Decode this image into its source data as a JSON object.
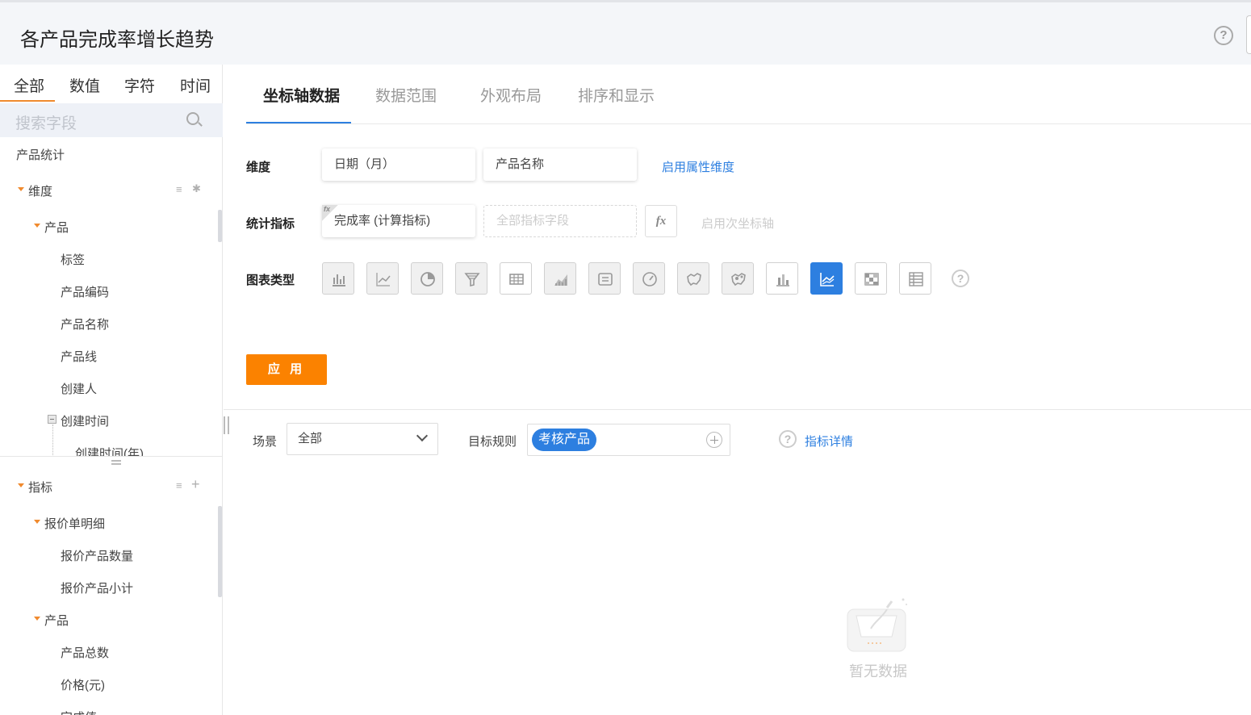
{
  "header": {
    "title": "各产品完成率增长趋势"
  },
  "sidebar": {
    "field_tabs": [
      "全部",
      "数值",
      "字符",
      "时间"
    ],
    "search_placeholder": "搜索字段",
    "dataset": "产品统计",
    "dimensions": {
      "label": "维度",
      "group": "产品",
      "fields": [
        "标签",
        "产品编码",
        "产品名称",
        "产品线",
        "创建人"
      ],
      "date_group": "创建时间",
      "date_child": "创建时间(年)"
    },
    "metrics": {
      "label": "指标",
      "groups": [
        {
          "name": "报价单明细",
          "fields": [
            "报价产品数量",
            "报价产品小计"
          ]
        },
        {
          "name": "产品",
          "fields": [
            "产品总数",
            "价格(元)",
            "完成值"
          ]
        }
      ]
    }
  },
  "config": {
    "tabs": [
      "坐标轴数据",
      "数据范围",
      "外观布局",
      "排序和显示"
    ],
    "dimension_label": "维度",
    "dimension_pills": [
      "日期（月）",
      "产品名称"
    ],
    "dimension_link": "启用属性维度",
    "metric_label": "统计指标",
    "metric_pill": "完成率 (计算指标)",
    "metric_placeholder": "全部指标字段",
    "fx_label": "fx",
    "secondary_axis": "启用次坐标轴",
    "chart_type_label": "图表类型",
    "chart_types": [
      "bar-chart-icon",
      "line-chart-icon",
      "pie-chart-icon",
      "funnel-chart-icon",
      "table-icon",
      "area-chart-icon",
      "text-card-icon",
      "gauge-icon",
      "map-icon",
      "map-bubble-icon",
      "stacked-bar-icon",
      "trend-line-icon",
      "heatmap-icon",
      "pivot-table-icon"
    ],
    "selected_chart_type": "trend-line-icon",
    "apply_label": "应 用"
  },
  "filter": {
    "scene_label": "场景",
    "scene_value": "全部",
    "rule_label": "目标规则",
    "rule_tag": "考核产品",
    "detail_link": "指标详情"
  },
  "empty": {
    "text": "暂无数据"
  },
  "colors": {
    "accent": "#2d7fe0",
    "apply": "#fb8200",
    "caret": "#f08a2e"
  }
}
